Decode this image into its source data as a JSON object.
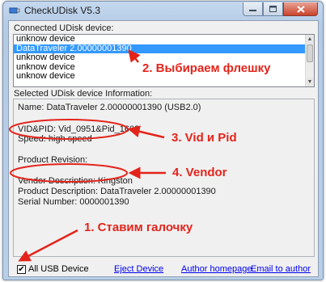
{
  "window": {
    "title": "CheckUDisk V5.3",
    "controls": {
      "minimize": "minimize-icon",
      "maximize": "maximize-icon",
      "close": "close-icon"
    }
  },
  "connected": {
    "label": "Connected UDisk device:",
    "items": [
      {
        "label": "unknow device",
        "selected": false
      },
      {
        "label": "DataTraveler 2.00000001390",
        "selected": true
      },
      {
        "label": "unknow device",
        "selected": false
      },
      {
        "label": "unknow device",
        "selected": false
      },
      {
        "label": "unknow device",
        "selected": false
      }
    ]
  },
  "info": {
    "label": "Selected UDisk device Information:",
    "name": "Name: DataTraveler 2.00000001390  (USB2.0)",
    "vidpid": "VID&PID: Vid_0951&Pid_1603",
    "speed": "Speed: high speed",
    "revision": "Product Revision:",
    "vendor": "Vendor Description: Kingston",
    "product": "Product Description: DataTraveler 2.00000001390",
    "serial": "Serial Number: 0000001390"
  },
  "bottom": {
    "checkbox_label": "All USB Device",
    "checkbox_checked": true,
    "eject": "Eject Device",
    "homepage": "Author homepage",
    "email": "Email to author"
  },
  "annotations": {
    "step2": "2. Выбираем флешку",
    "step3": "3. Vid и Pid",
    "step4": "4. Vendor",
    "step1": "1. Ставим галочку",
    "color": "#e3241b"
  }
}
